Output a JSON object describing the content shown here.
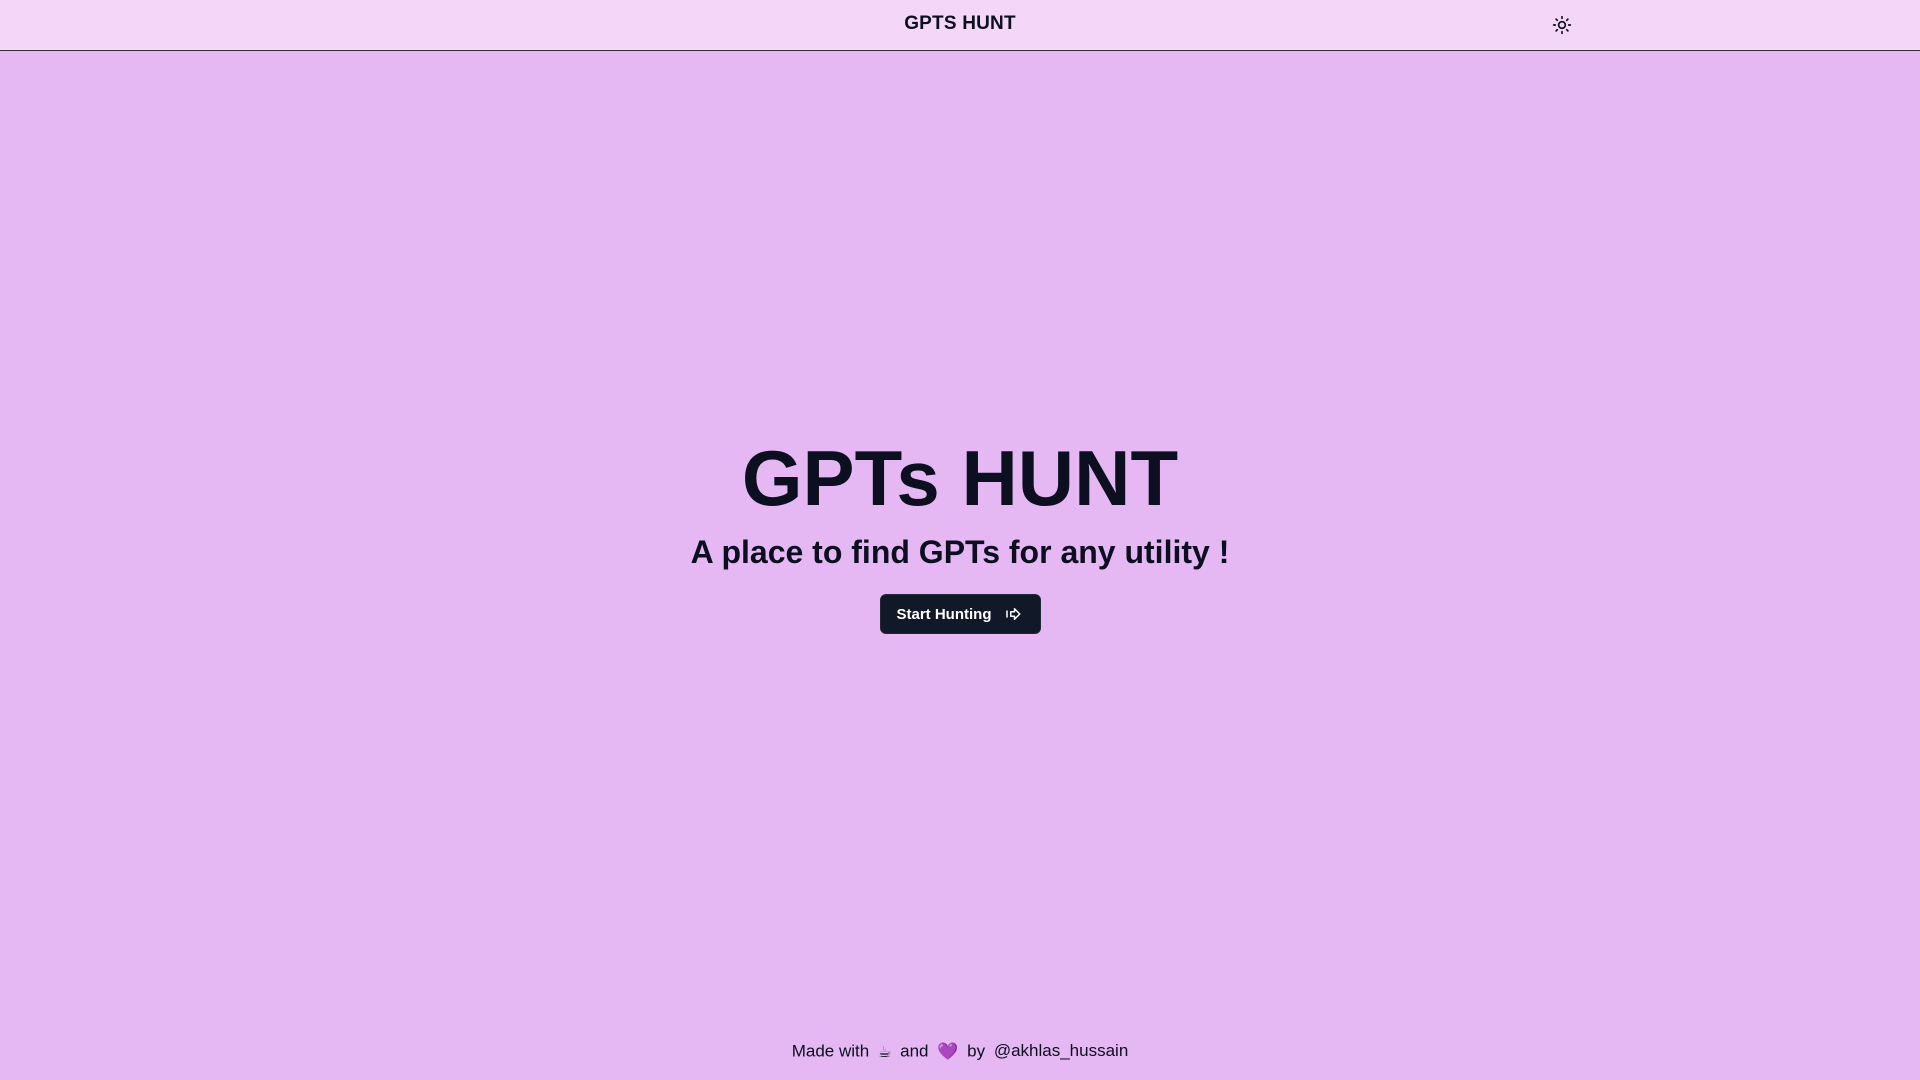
{
  "header": {
    "brand": "GPTS HUNT",
    "theme_icon": "sun-icon"
  },
  "hero": {
    "title": "GPTs HUNT",
    "subtitle": "A place to find GPTs for any utility !",
    "cta_label": "Start Hunting",
    "cta_icon": "arrow-right-icon"
  },
  "footer": {
    "made_with": "Made with",
    "coffee": "☕",
    "and": "and",
    "heart": "💜",
    "by": "by",
    "handle": "@akhlas_hussain"
  },
  "colors": {
    "background": "#e6b8f3",
    "navbar": "#f3d6f8",
    "button": "#111827",
    "text": "#0b0f1f"
  }
}
